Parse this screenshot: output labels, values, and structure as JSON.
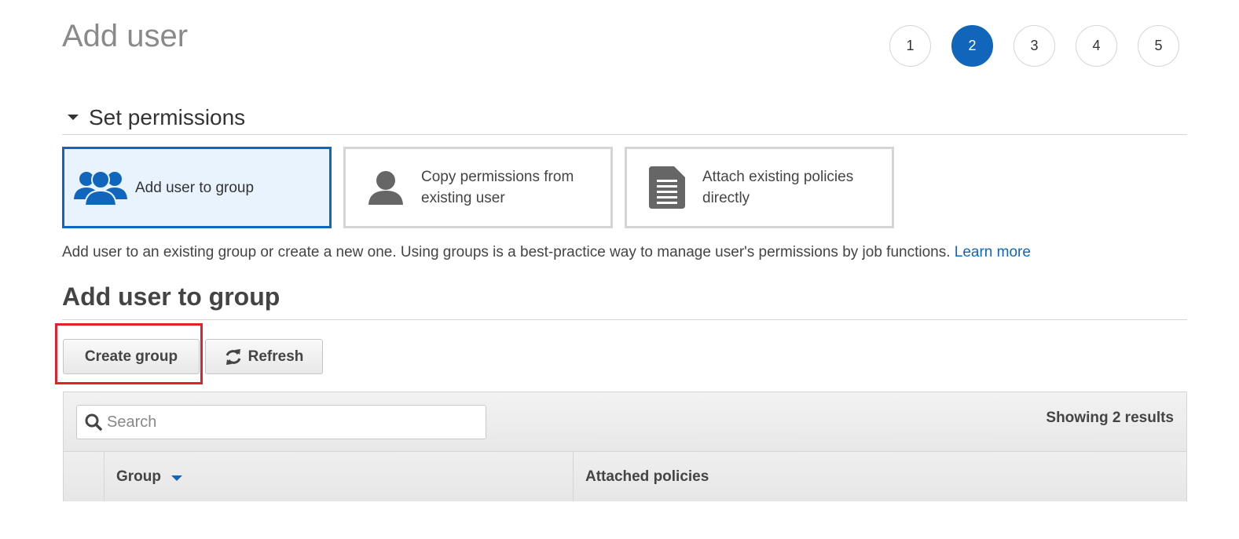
{
  "page": {
    "title": "Add user"
  },
  "steps": [
    {
      "label": "1",
      "active": false
    },
    {
      "label": "2",
      "active": true
    },
    {
      "label": "3",
      "active": false
    },
    {
      "label": "4",
      "active": false
    },
    {
      "label": "5",
      "active": false
    }
  ],
  "section": {
    "title": "Set permissions"
  },
  "options": [
    {
      "label": "Add user to group",
      "icon": "users-group-icon",
      "selected": true
    },
    {
      "label_line1": "Copy permissions from",
      "label_line2": "existing user",
      "icon": "user-icon",
      "selected": false
    },
    {
      "label_line1": "Attach existing policies",
      "label_line2": "directly",
      "icon": "document-icon",
      "selected": false
    }
  ],
  "description": {
    "text": "Add user to an existing group or create a new one. Using groups is a best-practice way to manage user's permissions by job functions. ",
    "link": "Learn more"
  },
  "subheading": "Add user to group",
  "buttons": {
    "create_group": "Create group",
    "refresh": "Refresh"
  },
  "table": {
    "search_placeholder": "Search",
    "results": "Showing 2 results",
    "columns": {
      "group": "Group",
      "attached_policies": "Attached policies"
    }
  },
  "colors": {
    "accent": "#1166bb",
    "selected_bg": "#e8f3fd",
    "highlight": "#e0202a"
  }
}
